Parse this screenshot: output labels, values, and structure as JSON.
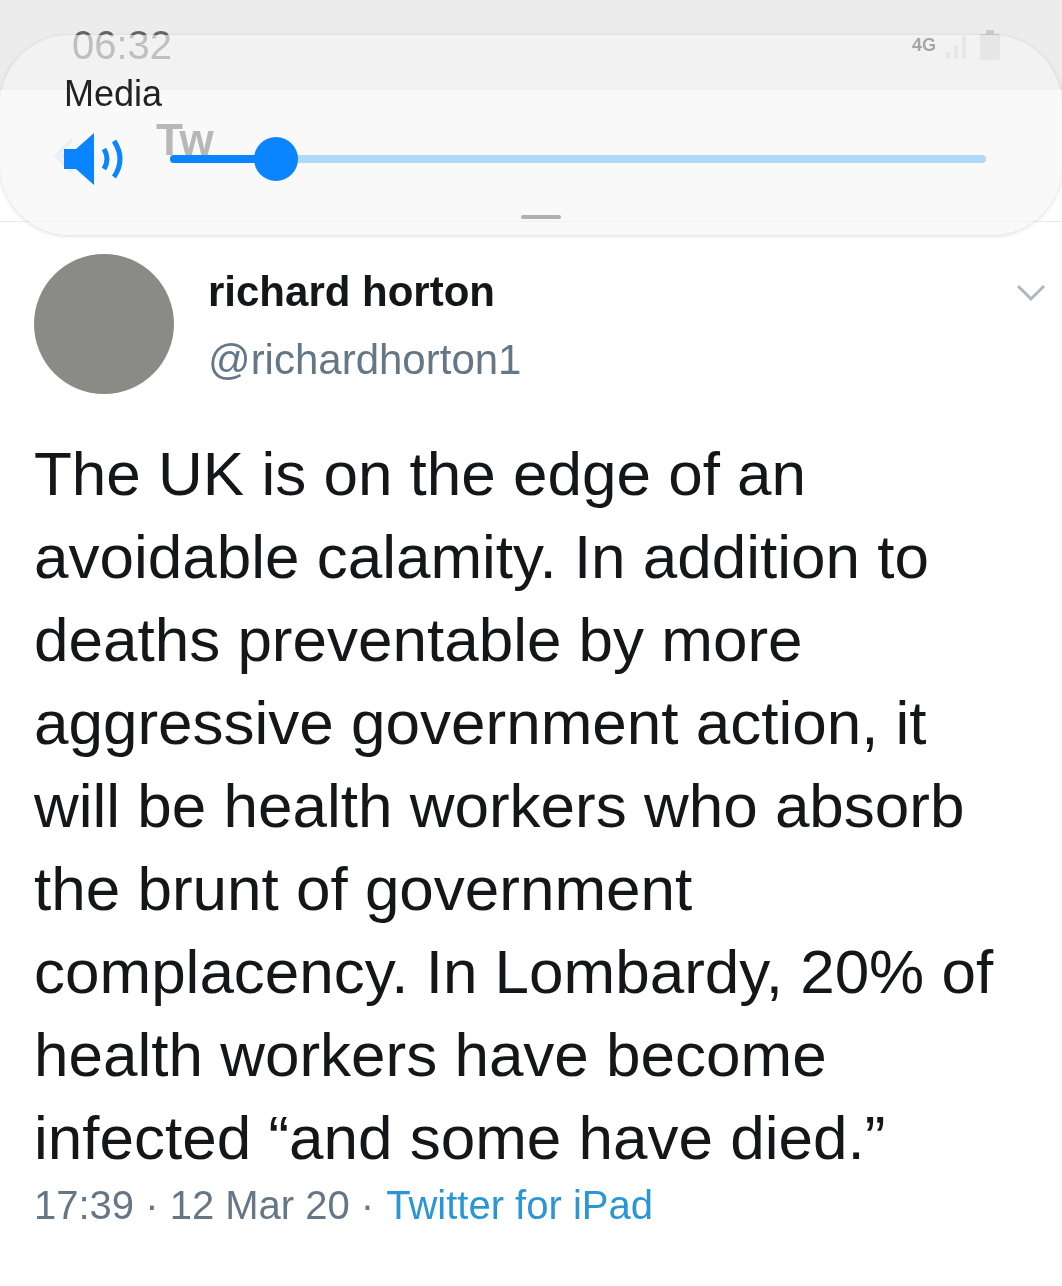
{
  "status_bar": {
    "time": "06:32",
    "network": "4G"
  },
  "header": {
    "title": "Tw"
  },
  "volume_panel": {
    "title": "Media",
    "level": 0.13
  },
  "tweet": {
    "author": {
      "name": "richard horton",
      "handle": "@richardhorton1"
    },
    "text": "The UK is on the edge of an avoidable calamity. In addition to deaths preventable by more aggressive government action, it will be health workers who absorb the brunt of government complacency. In Lombardy, 20% of health workers have become infected “and some have died.”",
    "timestamp": "17:39 · 12 Mar 20 ·",
    "source": "Twitter for iPad"
  }
}
